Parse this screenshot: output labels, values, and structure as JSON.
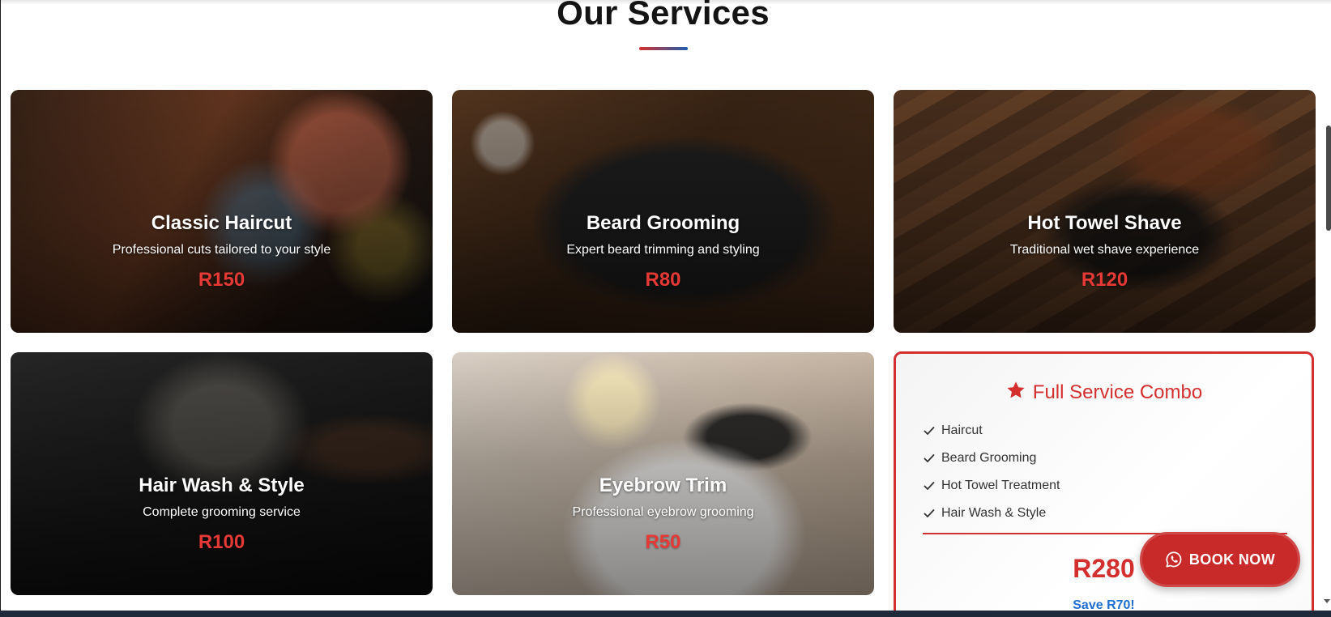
{
  "section": {
    "title": "Our Services"
  },
  "services": [
    {
      "title": "Classic Haircut",
      "description": "Professional cuts tailored to your style",
      "price": "R150",
      "image": "barbershop-interior-photo"
    },
    {
      "title": "Beard Grooming",
      "description": "Expert beard trimming and styling",
      "price": "R80",
      "image": "grooming-tools-photo"
    },
    {
      "title": "Hot Towel Shave",
      "description": "Traditional wet shave experience",
      "price": "R120",
      "image": "shaving-kit-photo"
    },
    {
      "title": "Hair Wash & Style",
      "description": "Complete grooming service",
      "price": "R100",
      "image": "client-in-barber-chair-photo"
    },
    {
      "title": "Eyebrow Trim",
      "description": "Professional eyebrow grooming",
      "price": "R50",
      "image": "hair-dryer-photo"
    }
  ],
  "combo": {
    "icon": "star-icon",
    "title": "Full Service Combo",
    "items": [
      "Haircut",
      "Beard Grooming",
      "Hot Towel Treatment",
      "Hair Wash & Style"
    ],
    "price": "R280",
    "savings": "Save R70!"
  },
  "book_button": {
    "icon": "whatsapp-icon",
    "label": "BOOK NOW"
  },
  "colors": {
    "accent_red": "#d32f2f",
    "accent_blue": "#1f6fd1",
    "price_red": "#e53935"
  }
}
